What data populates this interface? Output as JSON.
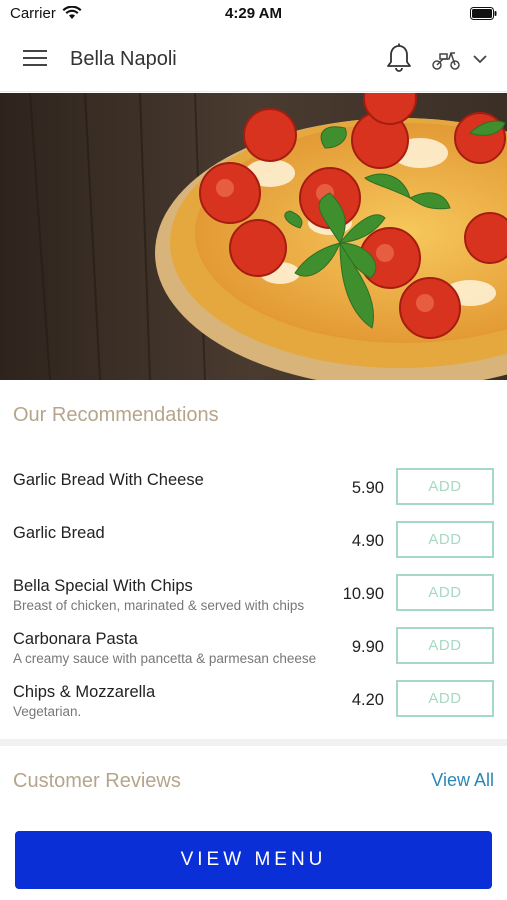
{
  "status_bar": {
    "carrier": "Carrier",
    "time": "4:29 AM"
  },
  "nav": {
    "title": "Bella Napoli",
    "icons": [
      "menu-icon",
      "bell-icon",
      "scooter-icon",
      "chevron-down-icon"
    ]
  },
  "recommendations": {
    "title": "Our Recommendations",
    "items": [
      {
        "name": "Garlic Bread With Cheese",
        "description": "",
        "price": "5.90",
        "action": "ADD"
      },
      {
        "name": "Garlic Bread",
        "description": "",
        "price": "4.90",
        "action": "ADD"
      },
      {
        "name": "Bella Special With Chips",
        "description": "Breast of chicken, marinated & served with chips",
        "price": "10.90",
        "action": "ADD"
      },
      {
        "name": "Carbonara Pasta",
        "description": "A creamy sauce with pancetta & parmesan cheese",
        "price": "9.90",
        "action": "ADD"
      },
      {
        "name": "Chips & Mozzarella",
        "description": "Vegetarian.",
        "price": "4.20",
        "action": "ADD"
      }
    ]
  },
  "reviews": {
    "title": "Customer Reviews",
    "view_all": "View All"
  },
  "cta": {
    "view_menu": "VIEW MENU"
  },
  "colors": {
    "accent_blue": "#0a2fd6",
    "add_border": "#a6d9c3",
    "section_title": "#b5a58c",
    "link": "#2c86b8"
  }
}
